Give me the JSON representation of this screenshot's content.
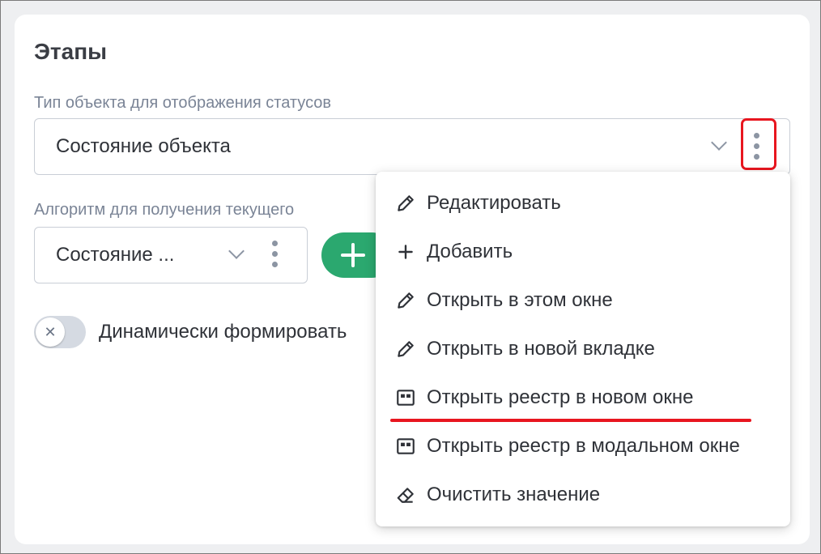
{
  "section": {
    "title": "Этапы"
  },
  "status_type": {
    "label": "Тип объекта для отображения статусов",
    "value": "Состояние объекта"
  },
  "algorithm": {
    "label": "Алгоритм для получения текущего",
    "value": "Состояние ..."
  },
  "dynamic_toggle": {
    "label": "Динамически формировать",
    "checked": false
  },
  "context_menu": {
    "items": [
      {
        "label": "Редактировать",
        "icon": "pencil-icon"
      },
      {
        "label": "Добавить",
        "icon": "plus-icon"
      },
      {
        "label": "Открыть в этом окне",
        "icon": "pencil-icon"
      },
      {
        "label": "Открыть в новой вкладке",
        "icon": "pencil-icon"
      },
      {
        "label": "Открыть реестр в новом окне",
        "icon": "registry-icon"
      },
      {
        "label": "Открыть реестр в модальном окне",
        "icon": "registry-icon"
      },
      {
        "label": "Очистить значение",
        "icon": "eraser-icon"
      }
    ]
  },
  "colors": {
    "accent_green": "#2ba86f",
    "highlight_red": "#e8161f",
    "text": "#2f3238",
    "label": "#7a8496"
  }
}
